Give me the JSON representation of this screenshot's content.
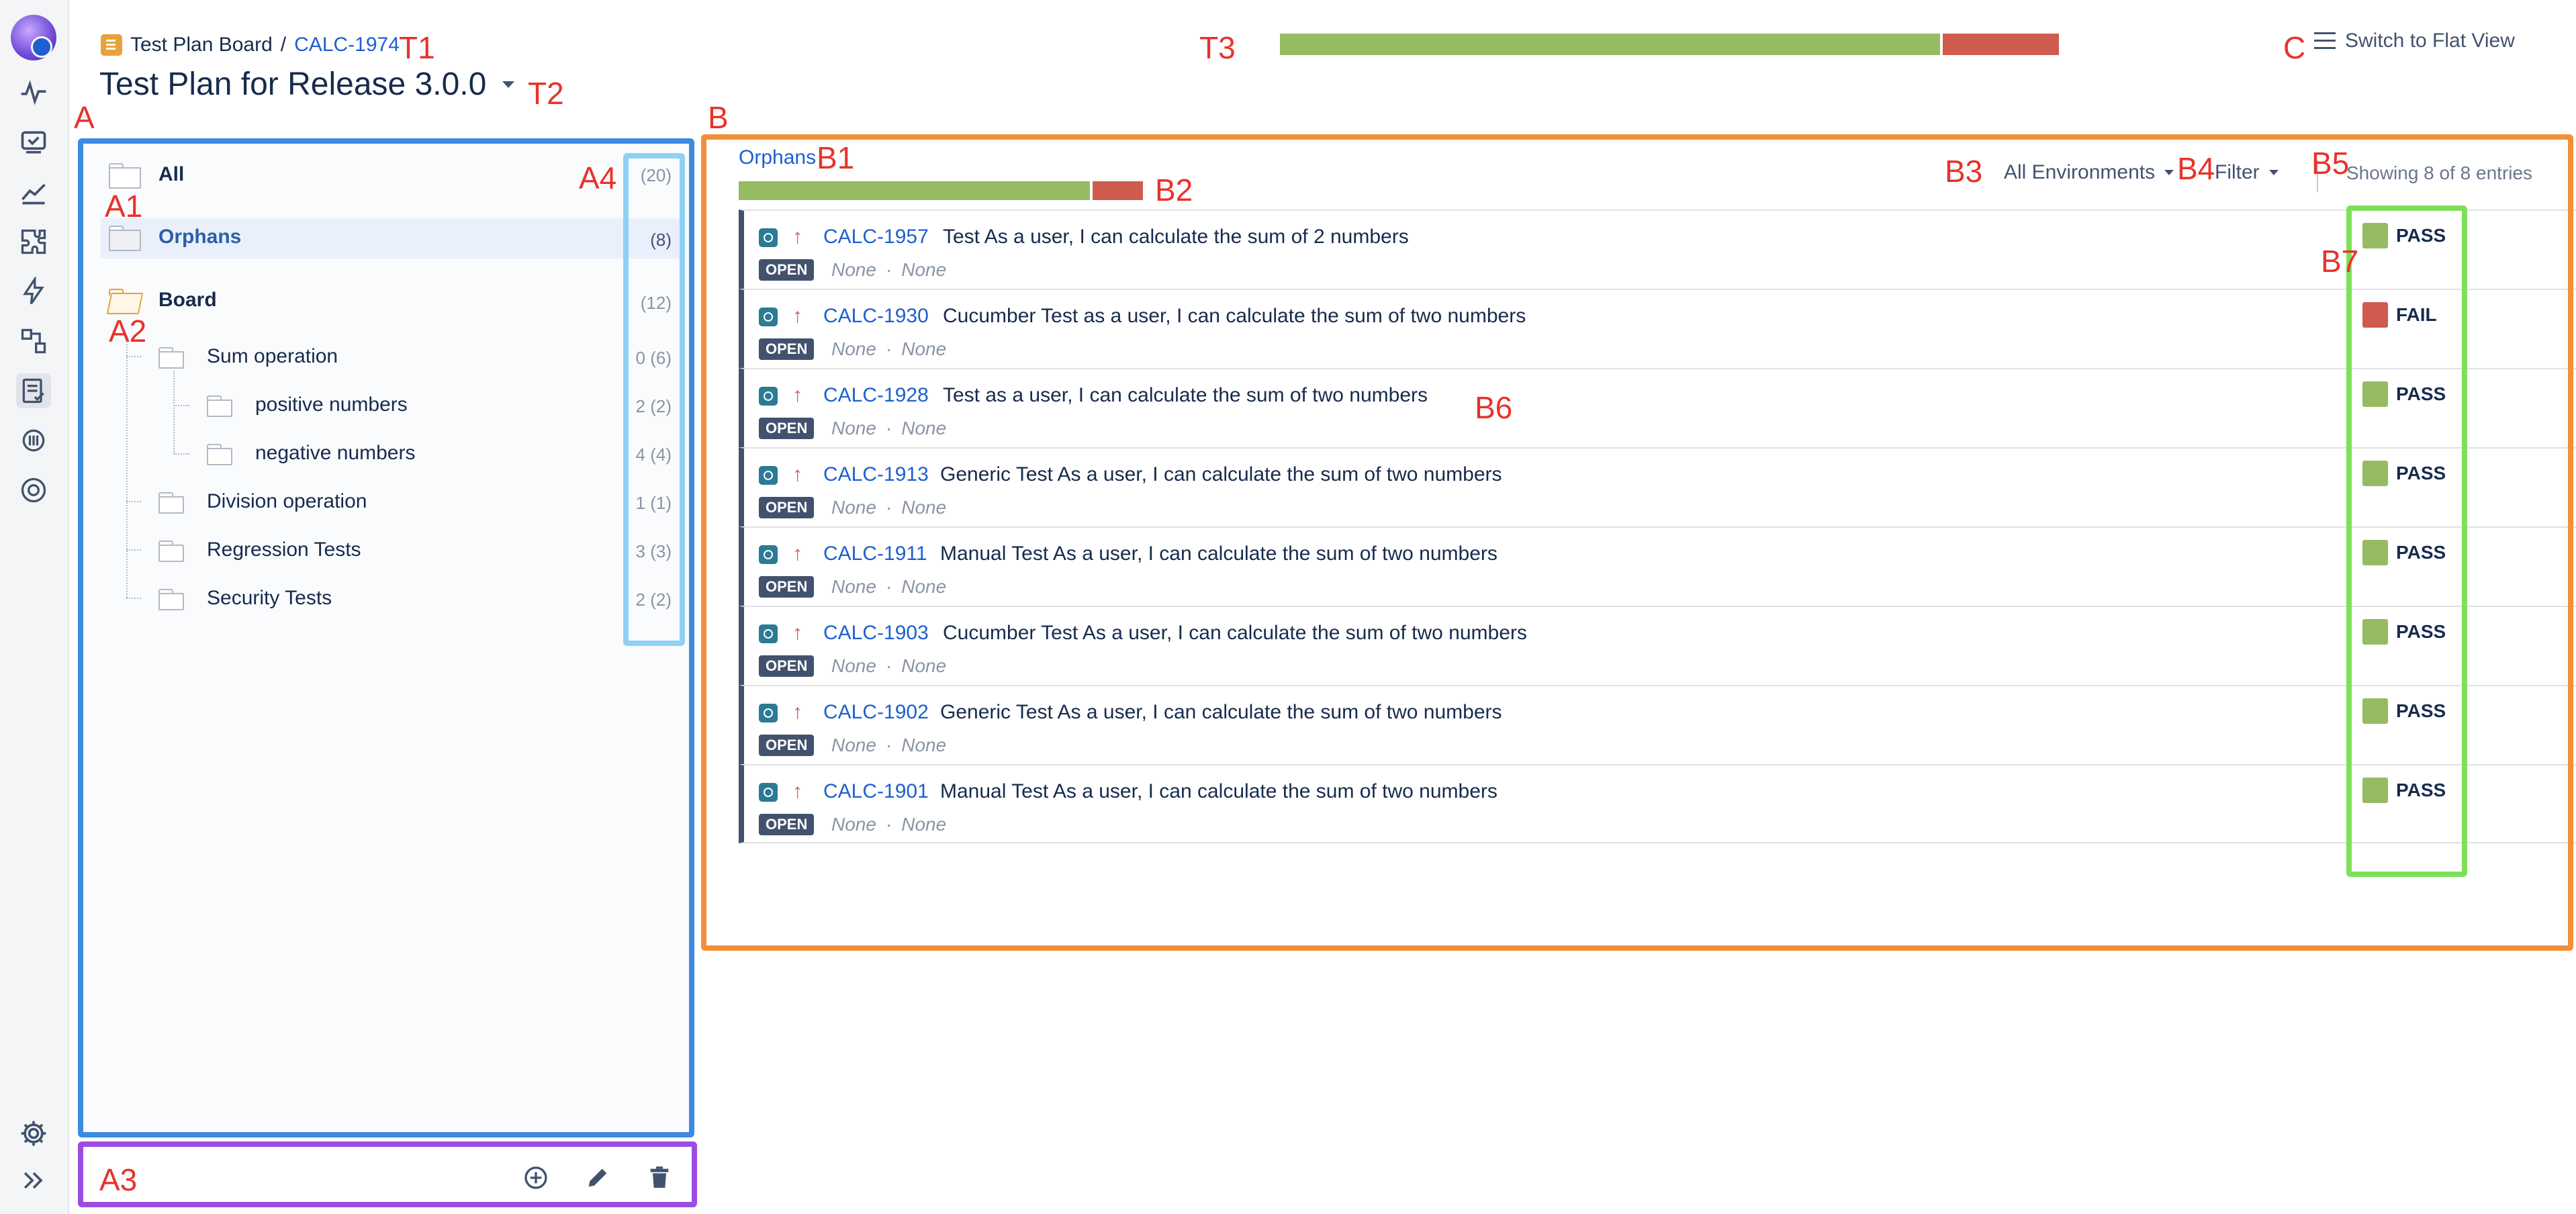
{
  "header": {
    "breadcrumb_board": "Test Plan Board",
    "breadcrumb_sep": "/",
    "breadcrumb_key": "CALC-1974",
    "title": "Test Plan for Release 3.0.0",
    "switch_view": "Switch to Flat View",
    "overall_progress": {
      "pass_fraction": 0.85,
      "fail_fraction": 0.15
    }
  },
  "tree": {
    "all": {
      "label": "All",
      "count": "(20)"
    },
    "orphans": {
      "label": "Orphans",
      "count": "(8)"
    },
    "board": {
      "label": "Board",
      "count": "(12)"
    },
    "folders": [
      {
        "label": "Sum operation",
        "count": "0 (6)"
      },
      {
        "label": "positive numbers",
        "count": "2 (2)"
      },
      {
        "label": "negative numbers",
        "count": "4 (4)"
      },
      {
        "label": "Division operation",
        "count": "1 (1)"
      },
      {
        "label": "Regression Tests",
        "count": "3 (3)"
      },
      {
        "label": "Security Tests",
        "count": "2 (2)"
      }
    ]
  },
  "panel": {
    "section": "Orphans",
    "section_progress": {
      "pass_fraction": 0.875,
      "fail_fraction": 0.125
    },
    "env_filter": "All Environments",
    "filter": "Filter",
    "showing": "Showing 8 of 8 entries"
  },
  "tests": [
    {
      "key": "CALC-1957",
      "summary": "Test As a user, I can calculate the sum of 2 numbers",
      "status_badge": "OPEN",
      "meta1": "None",
      "meta2": "None",
      "result": "PASS"
    },
    {
      "key": "CALC-1930",
      "summary": "Cucumber Test as a user, I can calculate the sum of two numbers",
      "status_badge": "OPEN",
      "meta1": "None",
      "meta2": "None",
      "result": "FAIL"
    },
    {
      "key": "CALC-1928",
      "summary": "Test as a user, I can calculate the sum of two numbers",
      "status_badge": "OPEN",
      "meta1": "None",
      "meta2": "None",
      "result": "PASS"
    },
    {
      "key": "CALC-1913",
      "summary": "Generic Test As a user, I can calculate the sum of two numbers",
      "status_badge": "OPEN",
      "meta1": "None",
      "meta2": "None",
      "result": "PASS"
    },
    {
      "key": "CALC-1911",
      "summary": "Manual Test As a user, I can calculate the sum of two numbers",
      "status_badge": "OPEN",
      "meta1": "None",
      "meta2": "None",
      "result": "PASS"
    },
    {
      "key": "CALC-1903",
      "summary": "Cucumber Test As a user, I can calculate the sum of two numbers",
      "status_badge": "OPEN",
      "meta1": "None",
      "meta2": "None",
      "result": "PASS"
    },
    {
      "key": "CALC-1902",
      "summary": "Generic Test As a user, I can calculate the sum of two numbers",
      "status_badge": "OPEN",
      "meta1": "None",
      "meta2": "None",
      "result": "PASS"
    },
    {
      "key": "CALC-1901",
      "summary": "Manual Test As a user, I can calculate the sum of two numbers",
      "status_badge": "OPEN",
      "meta1": "None",
      "meta2": "None",
      "result": "PASS"
    }
  ],
  "annotations": {
    "T1": "T1",
    "T2": "T2",
    "T3": "T3",
    "C": "C",
    "A": "A",
    "A1": "A1",
    "A2": "A2",
    "A3": "A3",
    "A4": "A4",
    "B": "B",
    "B1": "B1",
    "B2": "B2",
    "B3": "B3",
    "B4": "B4",
    "B5": "B5",
    "B6": "B6",
    "B7": "B7"
  },
  "colors": {
    "pass": "#97bb62",
    "fail": "#cf5b4f",
    "link": "#1d5fd0",
    "annotation": "#e8322b",
    "box_tree": "#3d8be0",
    "box_counts": "#8fd0f5",
    "box_footer": "#9b4de0",
    "box_panel": "#f0913a",
    "box_results": "#7ee05a"
  },
  "icons": {
    "rail": [
      "activity-icon",
      "test-execution-icon",
      "reports-icon",
      "puzzle-icon",
      "lightning-icon",
      "test-repository-icon",
      "test-plan-icon",
      "coverage-icon",
      "settings-circle-icon"
    ],
    "rail_bottom": [
      "gear-icon",
      "expand-icon"
    ],
    "footer": [
      "add-circle-icon",
      "pencil-icon",
      "trash-icon"
    ]
  }
}
